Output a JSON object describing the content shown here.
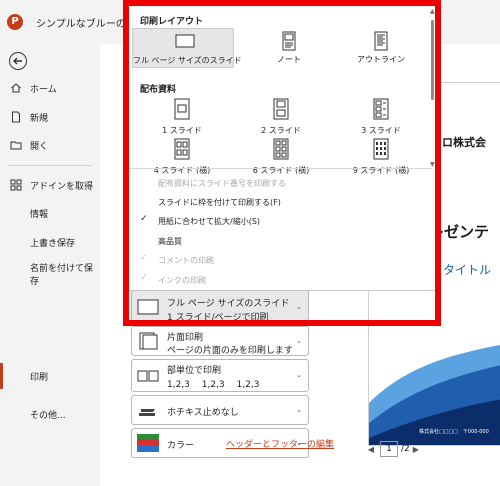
{
  "titlebar": {
    "app_logo": "P",
    "title": "シンプルなブルーのPowe"
  },
  "sidebar": {
    "items": [
      {
        "label": "ホーム",
        "icon": "home-icon"
      },
      {
        "label": "新規",
        "icon": "new-file-icon"
      },
      {
        "label": "開く",
        "icon": "folder-open-icon"
      },
      {
        "label": "アドインを取得",
        "icon": "addins-grid-icon"
      },
      {
        "label": "情報"
      },
      {
        "label": "上書き保存"
      },
      {
        "label": "名前を付けて保存"
      },
      {
        "label": "印刷"
      },
      {
        "label": "その他..."
      }
    ],
    "active_color": "#c43e1c"
  },
  "settings": {
    "layout": {
      "line1": "フル ページ サイズのスライド",
      "line2": "1 スライド/ページで印刷"
    },
    "sides": {
      "line1": "片面印刷",
      "line2": "ページの片面のみを印刷します"
    },
    "collate": {
      "line1": "部単位で印刷",
      "line2": "1,2,3　 1,2,3　 1,2,3"
    },
    "staple": {
      "line1": "ホチキス止めなし"
    },
    "color": {
      "line1": "カラー"
    },
    "footer_link": "ヘッダーとフッターの編集"
  },
  "preview": {
    "company": "コロ株式会",
    "title": "レゼンテ",
    "subtitle": "タイトル",
    "footer": "株式会社□□□□　〒000-000",
    "page_current": "1",
    "page_total": "/2"
  },
  "popup": {
    "section_print_layout": "印刷レイアウト",
    "layouts": [
      {
        "label": "フル ページ サイズのスライド",
        "selected": true
      },
      {
        "label": "ノート",
        "selected": false
      },
      {
        "label": "アウトライン",
        "selected": false
      }
    ],
    "section_handouts": "配布資料",
    "handouts": [
      "1 スライド",
      "2 スライド",
      "3 スライド",
      "4 スライド (横)",
      "6 スライド (横)",
      "9 スライド (横)"
    ],
    "options": [
      {
        "label": "配布資料にスライド番号を印刷する",
        "checked": false,
        "disabled": true
      },
      {
        "label": "スライドに枠を付けて印刷する(F)",
        "checked": false,
        "disabled": false
      },
      {
        "label": "用紙に合わせて拡大/縮小(S)",
        "checked": true,
        "disabled": false
      },
      {
        "label": "高品質",
        "checked": false,
        "disabled": false
      },
      {
        "label": "コメントの印刷",
        "checked": true,
        "disabled": true
      },
      {
        "label": "インクの印刷",
        "checked": true,
        "disabled": true
      }
    ],
    "highlight_color": "#ee0000"
  }
}
